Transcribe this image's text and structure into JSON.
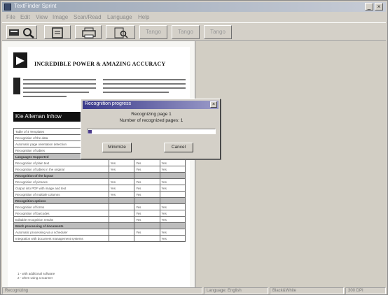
{
  "window": {
    "title": "TextFinder Sprint",
    "controls": {
      "minimize": "_",
      "close": "×"
    }
  },
  "menu": [
    "File",
    "Edit",
    "View",
    "Image",
    "Scan/Read",
    "Language",
    "Help"
  ],
  "toolbar": {
    "buttons": [
      {
        "name": "scan-and-read-button",
        "icon": "scan-magnifier-icon"
      },
      {
        "name": "open-document-button",
        "icon": "document-icon"
      },
      {
        "name": "print-button",
        "icon": "printer-icon"
      },
      {
        "name": "read-page-button",
        "icon": "read-page-icon"
      }
    ],
    "disabled_labels": [
      "Tango",
      "Tango",
      "Tango"
    ]
  },
  "document": {
    "headline": "INCREDIBLE POWER & AMAZING ACCURACY",
    "band_title": "Kie Alleman Inhow",
    "table_rows": [
      {
        "label": "Table of 4 Templates",
        "cols": [
          "",
          "",
          ""
        ],
        "header": false
      },
      {
        "label": "Recognition of the data",
        "cols": [
          "",
          "",
          ""
        ],
        "header": false
      },
      {
        "label": "Automatic page orientation detection",
        "cols": [
          "",
          "",
          ""
        ],
        "header": false
      },
      {
        "label": "Recognition of tables",
        "cols": [
          "Yes",
          "Yes",
          "Yes"
        ],
        "header": false
      },
      {
        "label": "Languages Supported",
        "cols": [
          "",
          "",
          ""
        ],
        "header": true
      },
      {
        "label": "Recognition of plain text",
        "cols": [
          "Yes",
          "Yes",
          "Yes"
        ],
        "header": false
      },
      {
        "label": "Recognition of tables in the original",
        "cols": [
          "Yes",
          "Yes",
          "Yes"
        ],
        "header": false
      },
      {
        "label": "Recognition of the layout",
        "cols": [
          "",
          "",
          ""
        ],
        "header": true
      },
      {
        "label": "Recognition of pictures",
        "cols": [
          "Yes",
          "Yes",
          "Yes"
        ],
        "header": false
      },
      {
        "label": "Output into PDF with image and text",
        "cols": [
          "Yes",
          "Yes",
          "Yes"
        ],
        "header": false
      },
      {
        "label": "Recognition of multiple columns",
        "cols": [
          "Yes",
          "Yes",
          ""
        ],
        "header": false
      },
      {
        "label": "Recognition options",
        "cols": [
          "",
          "",
          ""
        ],
        "header": true
      },
      {
        "label": "Recognition of forms",
        "cols": [
          "",
          "Yes",
          "Yes"
        ],
        "header": false
      },
      {
        "label": "Recognition of barcodes",
        "cols": [
          "",
          "Yes",
          "Yes"
        ],
        "header": false
      },
      {
        "label": "Editable recognition results",
        "cols": [
          "",
          "Yes",
          "Yes"
        ],
        "header": false
      },
      {
        "label": "Batch processing of documents",
        "cols": [
          "",
          "",
          ""
        ],
        "header": true
      },
      {
        "label": "Automatic processing via a scheduler",
        "cols": [
          "",
          "Yes",
          "Yes"
        ],
        "header": false
      },
      {
        "label": "Integration with document management systems",
        "cols": [
          "",
          "",
          "Yes"
        ],
        "header": false
      }
    ],
    "footnotes": [
      "1 - with additional software",
      "2 - when using a scanner"
    ]
  },
  "dialog": {
    "title": "Recognition progress",
    "line1": "Recognizing page 1",
    "line2": "Number of recognized pages: 1",
    "progress": 0.03,
    "minimize_label": "Minimize",
    "cancel_label": "Cancel"
  },
  "status": {
    "left": "Recognizing",
    "language": "Language: English",
    "mode": "Black&White",
    "resolution": "300 DPI"
  },
  "colors": {
    "title_bar_start": "#9aa6b6",
    "dialog_title_start": "#3a3a8a",
    "progress_fill": "#4a3a8a"
  }
}
